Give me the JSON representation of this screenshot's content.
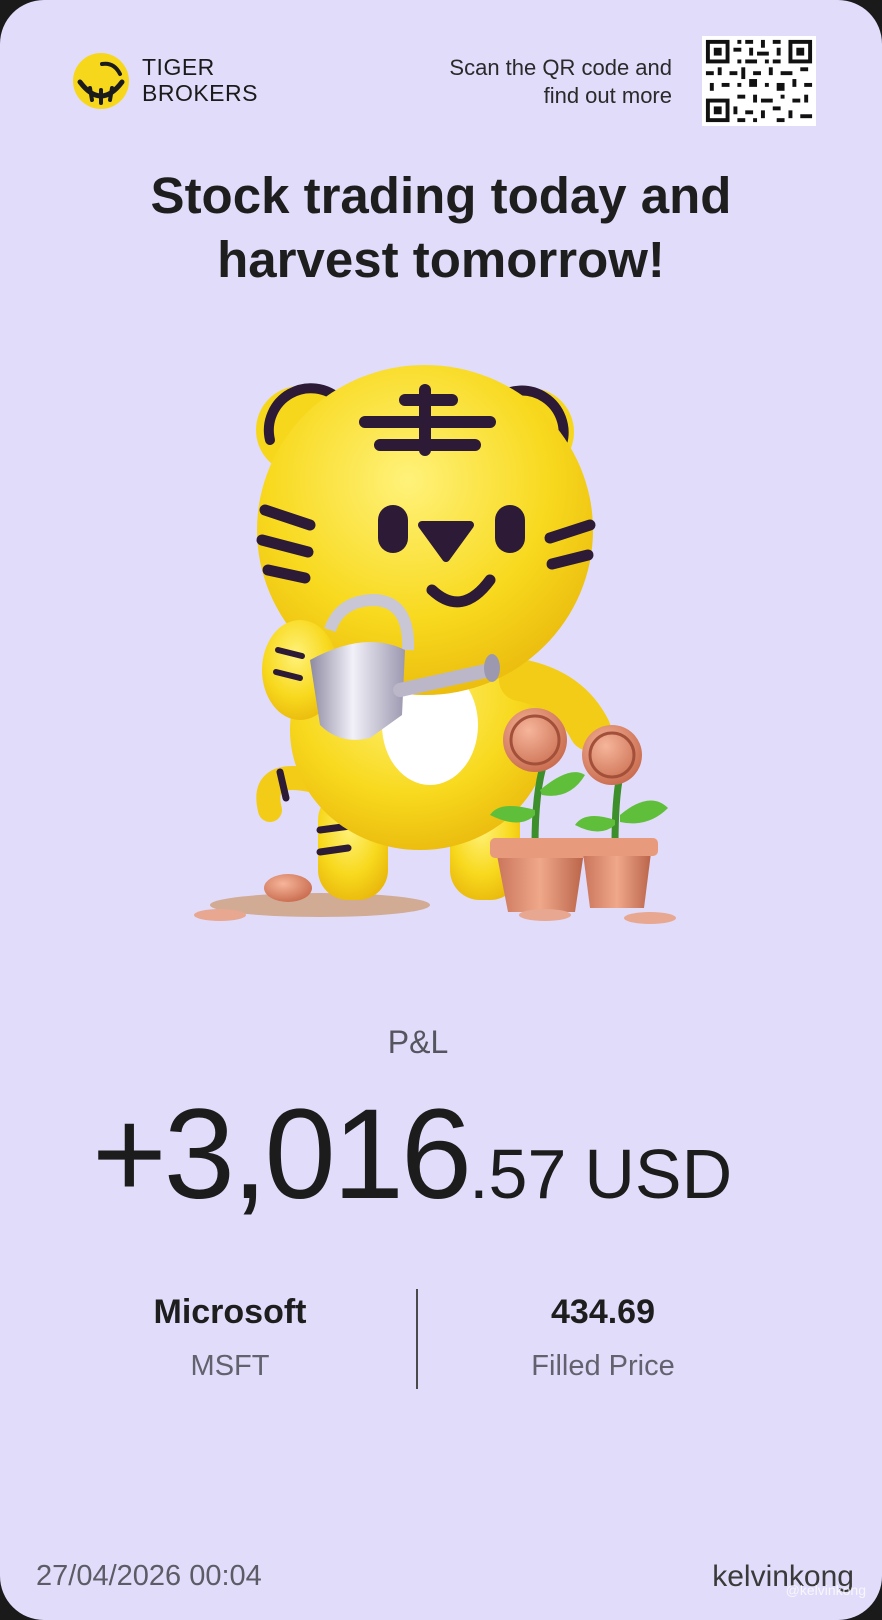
{
  "brand": {
    "line1": "TIGER",
    "line2": "BROKERS",
    "logo_icon": "tiger-logo-icon"
  },
  "qr": {
    "line1": "Scan the QR code and",
    "line2": "find out more",
    "icon": "qr-code-icon"
  },
  "headline": {
    "line1": "Stock trading today and",
    "line2": "harvest tomorrow!"
  },
  "illustration": {
    "icon": "tiger-mascot-watering-coin-plants-illustration"
  },
  "pnl": {
    "label": "P&L",
    "integer": "+3,016",
    "decimal": ".57",
    "currency": "USD"
  },
  "stock": {
    "name": "Microsoft",
    "ticker": "MSFT"
  },
  "price": {
    "value": "434.69",
    "label": "Filled Price"
  },
  "footer": {
    "timestamp": "27/04/2026 00:04",
    "username": "kelvinkong",
    "watermark": "@kelvinkong"
  },
  "colors": {
    "background": "#e1dcfa",
    "accent_yellow": "#f7d71c",
    "stripe_dark": "#2c1a36",
    "text_primary": "#1e1e1e",
    "text_secondary": "#62626e"
  }
}
